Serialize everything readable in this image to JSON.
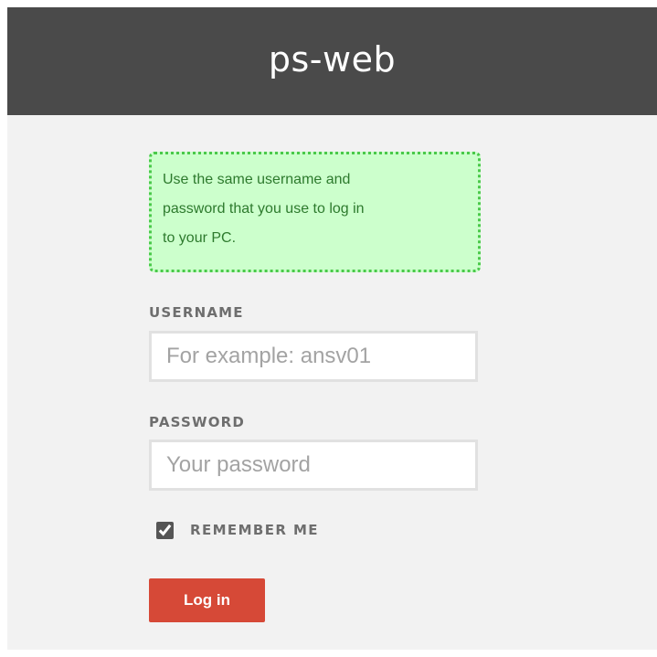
{
  "header": {
    "title": "ps-web"
  },
  "notice": {
    "line1": "Use the same username and",
    "line2": "password that you use to log in",
    "line3": "to your PC."
  },
  "form": {
    "username_label": "USERNAME",
    "username_placeholder": "For example: ansv01",
    "username_value": "",
    "password_label": "PASSWORD",
    "password_placeholder": "Your password",
    "password_value": "",
    "remember_label": "REMEMBER ME",
    "remember_checked": true,
    "login_label": "Log in"
  },
  "colors": {
    "header_bg": "#4a4a4a",
    "page_bg": "#f2f2f2",
    "notice_bg": "#ccffcc",
    "notice_border": "#4ac94a",
    "notice_text": "#2d7a2d",
    "button_bg": "#d64937"
  }
}
